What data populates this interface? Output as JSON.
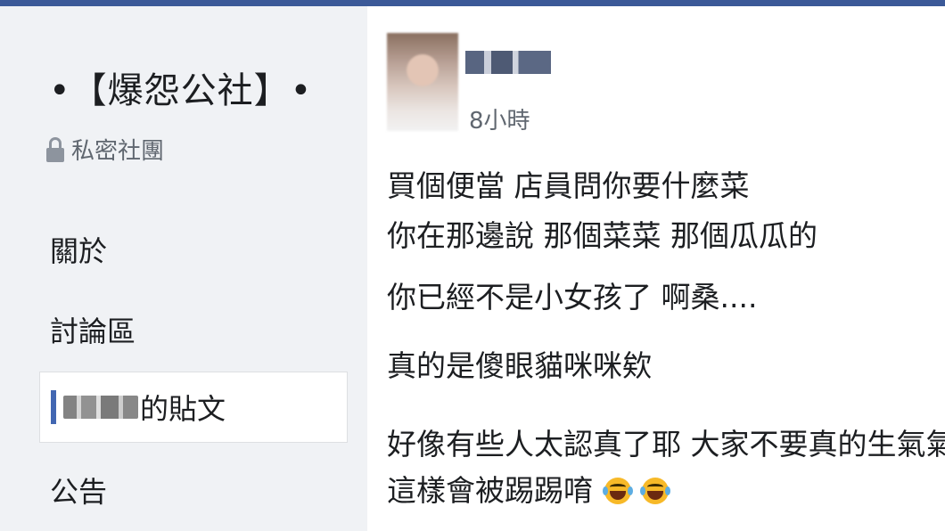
{
  "sidebar": {
    "group_title": "•【爆怨公社】•",
    "privacy_label": "私密社團",
    "nav_items": [
      {
        "label": "關於"
      },
      {
        "label": "討論區"
      },
      {
        "label": "的貼文"
      },
      {
        "label": "公告"
      }
    ]
  },
  "post": {
    "timestamp": "8小時",
    "lines": [
      "買個便當 店員問你要什麼菜",
      "你在那邊說 那個菜菜 那個瓜瓜的",
      "你已經不是小女孩了 啊桑....",
      "真的是傻眼貓咪咪欸",
      "好像有些人太認真了耶 大家不要真的生氣氣啦",
      "這樣會被踢踢唷"
    ],
    "emoji": [
      "crying-laughing-emoji",
      "crying-laughing-emoji"
    ]
  },
  "colors": {
    "brand": "#3b5998",
    "accent": "#4267b2",
    "sidebar_bg": "#f0f2f5",
    "text": "#1c1e21",
    "muted": "#606770"
  }
}
